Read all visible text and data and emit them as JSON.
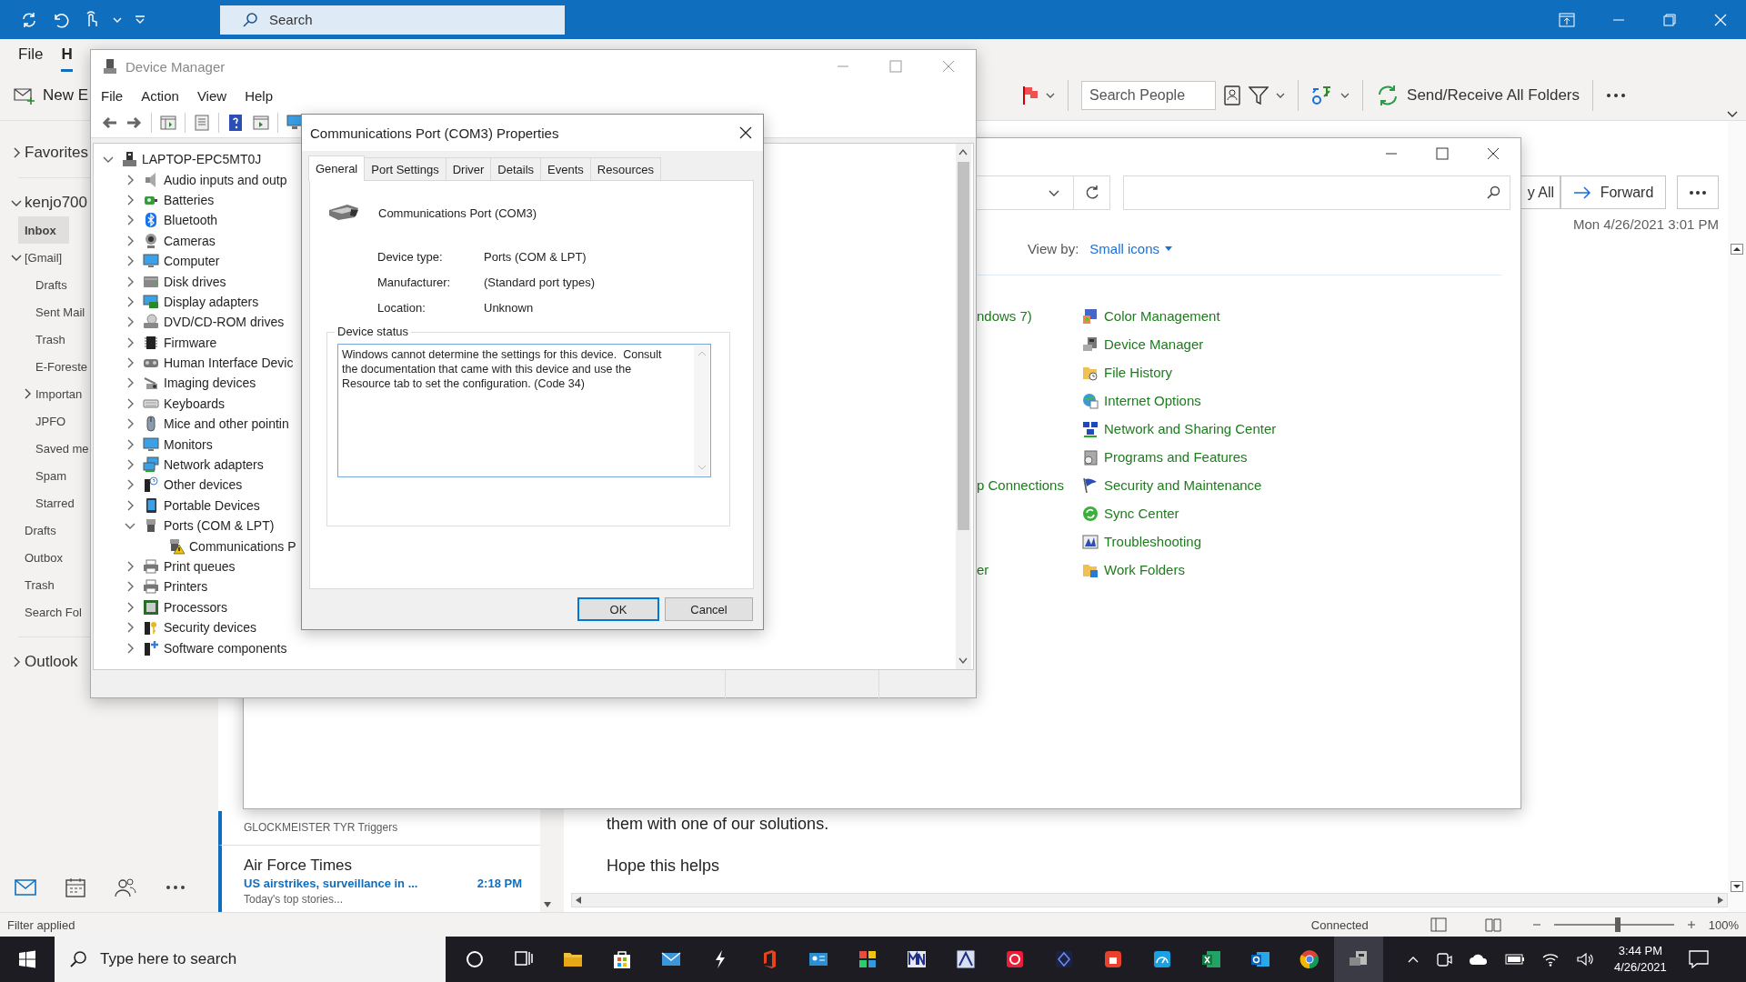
{
  "outlook": {
    "title_search": {
      "placeholder": "Search"
    },
    "ribbon_tabs": [
      {
        "label": "File",
        "selected": false
      },
      {
        "label": "H",
        "selected": true
      }
    ],
    "new_email": "New E",
    "search_people": {
      "placeholder": "Search People"
    },
    "send_receive": "Send/Receive All Folders",
    "folders": [
      {
        "label": "Favorites",
        "expanded": false,
        "selected": false
      },
      {
        "label": "kenjo700",
        "expanded": true,
        "selected": false,
        "children": [
          {
            "label": "Inbox",
            "selected": true
          },
          {
            "label": "[Gmail]",
            "expanded": true,
            "selected": false,
            "children": [
              {
                "label": "Drafts",
                "selected": false
              },
              {
                "label": "Sent Mail",
                "selected": false
              },
              {
                "label": "Trash",
                "selected": false
              },
              {
                "label": "E-Foreste",
                "selected": false
              },
              {
                "label": "Importan",
                "expanded": false,
                "selected": false
              },
              {
                "label": "JPFO",
                "selected": false
              },
              {
                "label": "Saved me",
                "selected": false
              },
              {
                "label": "Spam",
                "selected": false
              },
              {
                "label": "Starred",
                "selected": false
              }
            ]
          },
          {
            "label": "Drafts",
            "selected": false
          },
          {
            "label": "Outbox",
            "selected": false
          },
          {
            "label": "Trash",
            "selected": false
          },
          {
            "label": "Search Fol",
            "selected": false
          }
        ]
      },
      {
        "label": "Outlook",
        "expanded": false,
        "selected": false
      }
    ],
    "messages": [
      {
        "unread": true,
        "preview": "GLOCKMEISTER TYR Triggers"
      },
      {
        "unread": true,
        "sender": "Air Force Times",
        "subject": "US airstrikes, surveillance in ...",
        "time": "2:18 PM",
        "preview": "Today's top stories..."
      }
    ],
    "reading": {
      "reply_all": "y All",
      "forward": "Forward",
      "date": "Mon 4/26/2021 3:01 PM",
      "body": [
        "them with one of our solutions.",
        "Hope this helps"
      ]
    },
    "status": {
      "text": "Filter applied",
      "connection": "Connected",
      "zoom": "100%",
      "zoom_slider": {
        "level": 0.53
      }
    }
  },
  "taskbar": {
    "search": {
      "placeholder": "Type here to search"
    },
    "time": "3:44 PM",
    "date": "4/26/2021"
  },
  "control_panel": {
    "view_by_label": "View by:",
    "view_by_value": "Small icons",
    "items": [
      {
        "left": "ndows 7)",
        "right": "Color Management"
      },
      {
        "right": "Device Manager"
      },
      {
        "right": "File History"
      },
      {
        "right": "Internet Options"
      },
      {
        "right": "Network and Sharing Center"
      },
      {
        "right": "Programs and Features"
      },
      {
        "left": "p Connections",
        "right": "Security and Maintenance"
      },
      {
        "right": "Sync Center"
      },
      {
        "right": "Troubleshooting"
      },
      {
        "left": "er",
        "right": "Work Folders"
      }
    ]
  },
  "device_manager": {
    "title": "Device Manager",
    "menu": [
      "File",
      "Action",
      "View",
      "Help"
    ],
    "tree": {
      "label": "LAPTOP-EPC5MT0J",
      "expanded": true,
      "children": [
        {
          "label": "Audio inputs and outp",
          "expanded": false
        },
        {
          "label": "Batteries",
          "expanded": false
        },
        {
          "label": "Bluetooth",
          "expanded": false
        },
        {
          "label": "Cameras",
          "expanded": false
        },
        {
          "label": "Computer",
          "expanded": false
        },
        {
          "label": "Disk drives",
          "expanded": false
        },
        {
          "label": "Display adapters",
          "expanded": false
        },
        {
          "label": "DVD/CD-ROM drives",
          "expanded": false
        },
        {
          "label": "Firmware",
          "expanded": false
        },
        {
          "label": "Human Interface Devic",
          "expanded": false
        },
        {
          "label": "Imaging devices",
          "expanded": false
        },
        {
          "label": "Keyboards",
          "expanded": false
        },
        {
          "label": "Mice and other pointin",
          "expanded": false
        },
        {
          "label": "Monitors",
          "expanded": false
        },
        {
          "label": "Network adapters",
          "expanded": false
        },
        {
          "label": "Other devices",
          "expanded": false
        },
        {
          "label": "Portable Devices",
          "expanded": false
        },
        {
          "label": "Ports (COM & LPT)",
          "expanded": true,
          "children": [
            {
              "label": "Communications P",
              "warning": true
            }
          ]
        },
        {
          "label": "Print queues",
          "expanded": false
        },
        {
          "label": "Printers",
          "expanded": false
        },
        {
          "label": "Processors",
          "expanded": false
        },
        {
          "label": "Security devices",
          "expanded": false
        },
        {
          "label": "Software components",
          "expanded": false
        }
      ]
    }
  },
  "properties": {
    "title": "Communications Port (COM3) Properties",
    "tabs": [
      {
        "label": "General",
        "selected": true
      },
      {
        "label": "Port Settings",
        "selected": false
      },
      {
        "label": "Driver",
        "selected": false
      },
      {
        "label": "Details",
        "selected": false
      },
      {
        "label": "Events",
        "selected": false
      },
      {
        "label": "Resources",
        "selected": false
      }
    ],
    "device_name": "Communications Port (COM3)",
    "fields": [
      {
        "label": "Device type:",
        "value": "Ports (COM & LPT)"
      },
      {
        "label": "Manufacturer:",
        "value": "(Standard port types)"
      },
      {
        "label": "Location:",
        "value": "Unknown"
      }
    ],
    "status_group": "Device status",
    "status_text": "Windows cannot determine the settings for this device.  Consult the documentation that came with this device and use the Resource tab to set the configuration. (Code 34)",
    "buttons": [
      {
        "label": "OK",
        "default": true
      },
      {
        "label": "Cancel",
        "default": false
      }
    ]
  }
}
